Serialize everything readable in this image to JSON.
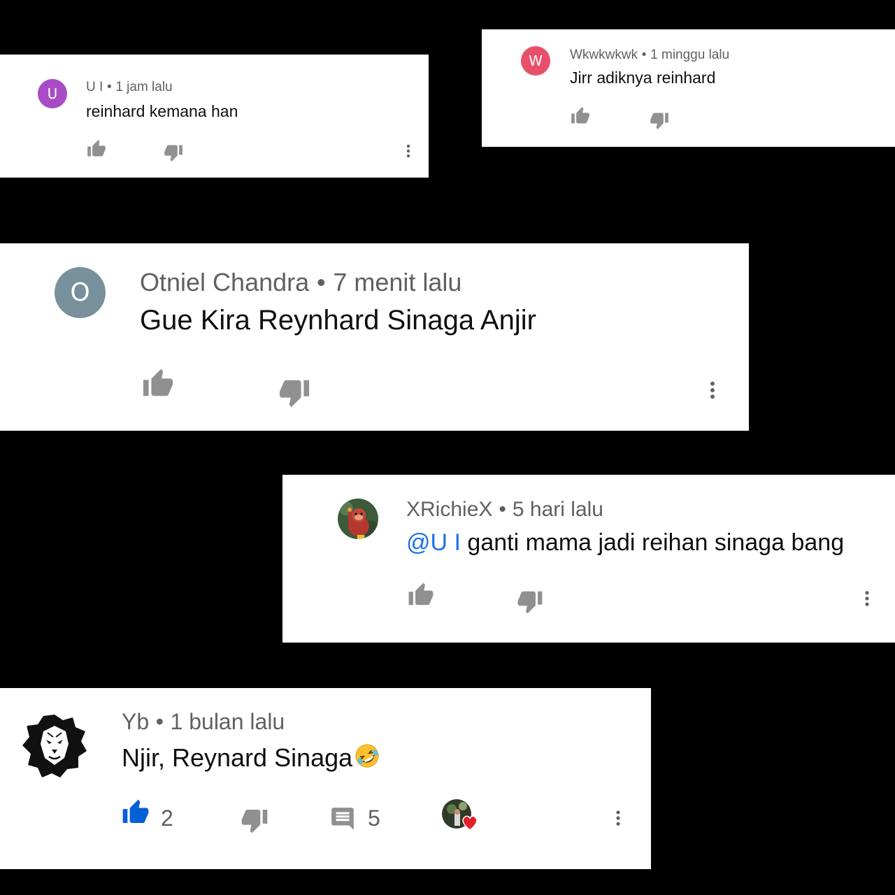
{
  "comments": [
    {
      "avatar_letter": "U",
      "author": "U I",
      "time": "1 jam lalu",
      "text": "reinhard kemana han"
    },
    {
      "avatar_letter": "W",
      "author": "Wkwkwkwk",
      "time": "1 minggu lalu",
      "text": "Jirr adiknya reinhard"
    },
    {
      "avatar_letter": "O",
      "author": "Otniel Chandra",
      "time": "7 menit lalu",
      "text": "Gue Kira Reynhard Sinaga Anjir"
    },
    {
      "author": "XRichieX",
      "time": "5 hari lalu",
      "mention": "@U I",
      "text": "ganti mama jadi reihan sinaga bang"
    },
    {
      "author": "Yb",
      "time": "1 bulan lalu",
      "text": "Njir, Reynard Sinaga",
      "emoji": "rolling-on-floor-laughing",
      "like_count": "2",
      "reply_count": "5",
      "liked": true,
      "creator_hearted": true
    }
  ],
  "colors": {
    "like_active": "#065fd4",
    "icon_grey": "#909090",
    "mention": "#1a73e8",
    "heart": "#e0202a"
  }
}
